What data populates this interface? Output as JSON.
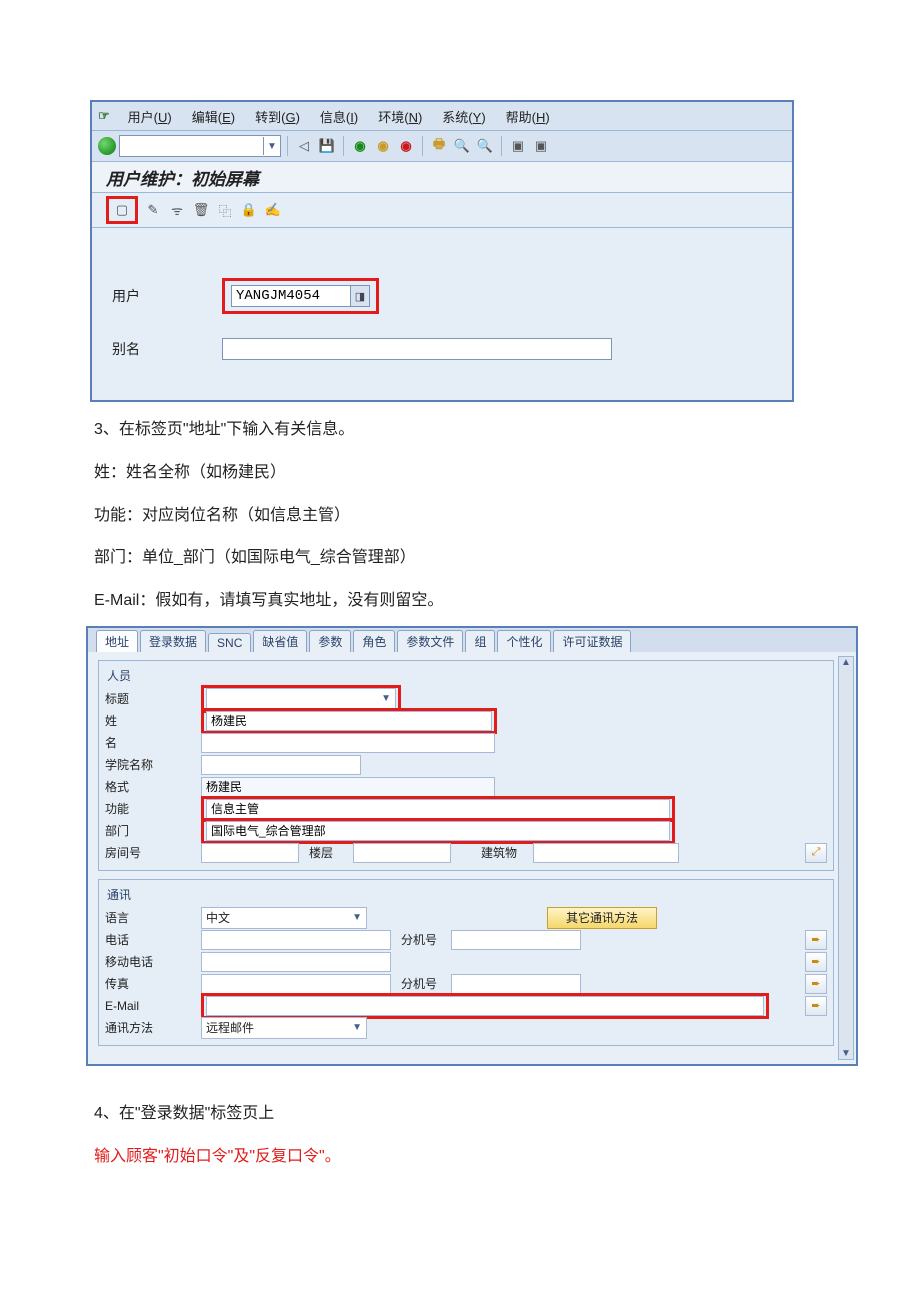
{
  "menu": {
    "items": [
      "用户(U)",
      "编辑(E)",
      "转到(G)",
      "信息(I)",
      "环境(N)",
      "系统(Y)",
      "帮助(H)"
    ]
  },
  "screen1": {
    "title": "用户维护：初始屏幕",
    "user_label": "用户",
    "user_value": "YANGJM4054",
    "alias_label": "别名",
    "alias_value": ""
  },
  "doc": {
    "p3": "3、在标签页\"地址\"下输入有关信息。",
    "pName": "姓：姓名全称（如杨建民）",
    "pFunc": "功能：对应岗位名称（如信息主管）",
    "pDept": "部门：单位_部门（如国际电气_综合管理部）",
    "pMail": "E-Mail：假如有，请填写真实地址，没有则留空。",
    "p4": "4、在\"登录数据\"标签页上",
    "p5": "输入顾客\"初始口令\"及\"反复口令\"。"
  },
  "tabs": [
    "地址",
    "登录数据",
    "SNC",
    "缺省值",
    "参数",
    "角色",
    "参数文件",
    "组",
    "个性化",
    "许可证数据"
  ],
  "grp_person": {
    "header": "人员",
    "title_lab": "标题",
    "title_val": "",
    "surname_lab": "姓",
    "surname_val": "杨建民",
    "name_lab": "名",
    "name_val": "",
    "acad_lab": "学院名称",
    "acad_val": "",
    "format_lab": "格式",
    "format_val": "杨建民",
    "func_lab": "功能",
    "func_val": "信息主管",
    "dept_lab": "部门",
    "dept_val": "国际电气_综合管理部",
    "room_lab": "房间号",
    "floor_lab": "楼层",
    "build_lab": "建筑物"
  },
  "grp_comm": {
    "header": "通讯",
    "lang_lab": "语言",
    "lang_val": "中文",
    "other_btn": "其它通讯方法",
    "phone_lab": "电话",
    "ext_lab": "分机号",
    "mobile_lab": "移动电话",
    "fax_lab": "传真",
    "email_lab": "E-Mail",
    "email_val": "",
    "method_lab": "通讯方法",
    "method_val": "远程邮件"
  }
}
